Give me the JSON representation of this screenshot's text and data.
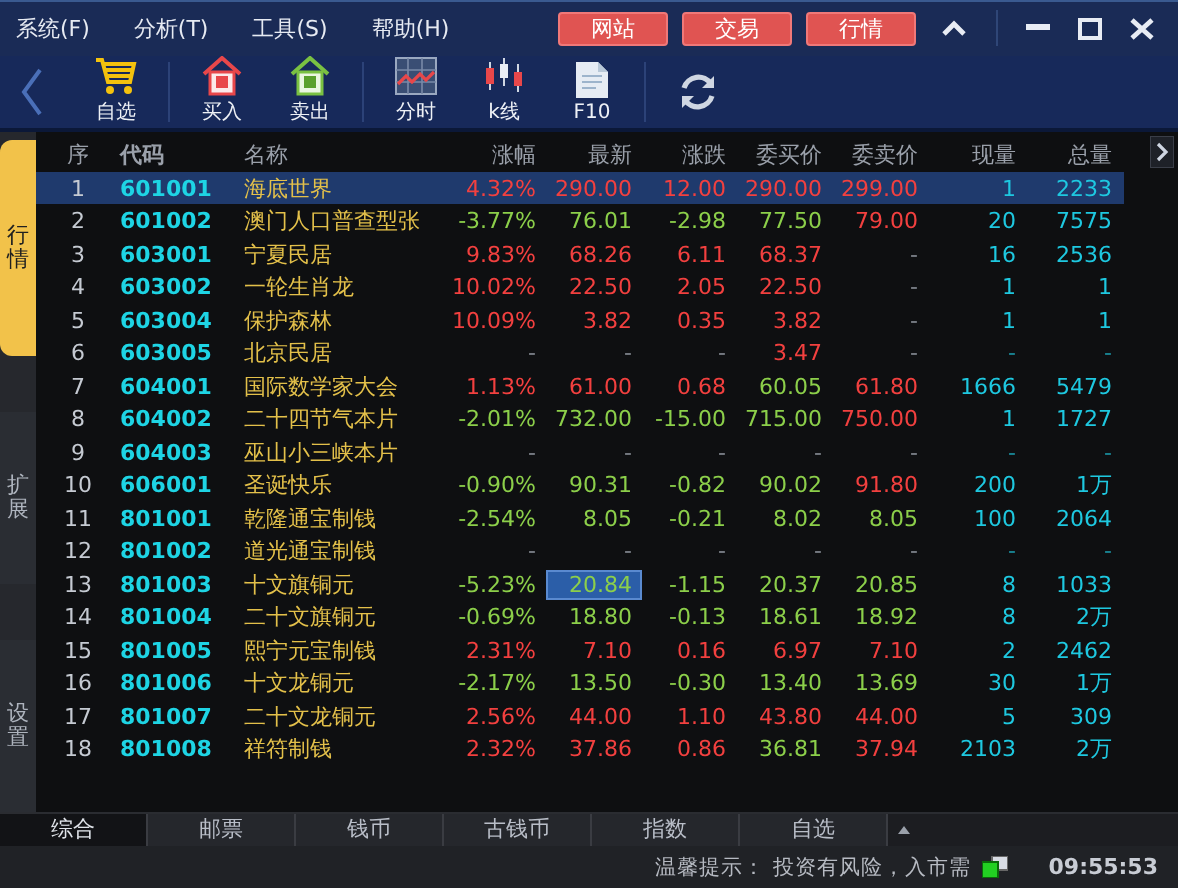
{
  "menu": [
    "系统(F)",
    "分析(T)",
    "工具(S)",
    "帮助(H)"
  ],
  "top_buttons": [
    "网站",
    "交易",
    "行情"
  ],
  "toolbar": [
    {
      "label": "自选",
      "kind": "cart"
    },
    {
      "label": "买入",
      "kind": "buy"
    },
    {
      "label": "卖出",
      "kind": "sell"
    },
    {
      "label": "分时",
      "kind": "intraday"
    },
    {
      "label": "k线",
      "kind": "kline"
    },
    {
      "label": "F10",
      "kind": "doc"
    },
    {
      "kind": "refresh"
    }
  ],
  "side_tabs": [
    {
      "label": "行情",
      "selected": true
    },
    {
      "label": "扩展",
      "selected": false
    },
    {
      "label": "设置",
      "selected": false
    }
  ],
  "table": {
    "columns": [
      "序",
      "代码",
      "名称",
      "涨幅",
      "最新",
      "涨跌",
      "委买价",
      "委卖价",
      "现量",
      "总量"
    ],
    "rows": [
      {
        "selected": true,
        "cells": [
          {
            "text": "1",
            "color": "#c5cad2",
            "selected": false
          },
          {
            "text": "601001",
            "color": "#1ed4e4",
            "selected": false
          },
          {
            "text": "海底世界",
            "color": "#e3c04a",
            "selected": false
          },
          {
            "text": "4.32%",
            "color": "#f2403f",
            "selected": false
          },
          {
            "text": "290.00",
            "color": "#f2403f",
            "selected": false
          },
          {
            "text": "12.00",
            "color": "#f2403f",
            "selected": false
          },
          {
            "text": "290.00",
            "color": "#f2403f",
            "selected": false
          },
          {
            "text": "299.00",
            "color": "#f2403f",
            "selected": false
          },
          {
            "text": "1",
            "color": "#1ec8e0",
            "selected": false
          },
          {
            "text": "2233",
            "color": "#1ec8e0",
            "selected": false
          }
        ]
      },
      {
        "selected": false,
        "cells": [
          {
            "text": "2",
            "color": "#c5cad2",
            "selected": false
          },
          {
            "text": "601002",
            "color": "#1ed4e4",
            "selected": false
          },
          {
            "text": "澳门人口普查型张",
            "color": "#e3c04a",
            "selected": false
          },
          {
            "text": "-3.77%",
            "color": "#8ccf4a",
            "selected": false
          },
          {
            "text": "76.01",
            "color": "#8ccf4a",
            "selected": false
          },
          {
            "text": "-2.98",
            "color": "#8ccf4a",
            "selected": false
          },
          {
            "text": "77.50",
            "color": "#8ccf4a",
            "selected": false
          },
          {
            "text": "79.00",
            "color": "#f2403f",
            "selected": false
          },
          {
            "text": "20",
            "color": "#1ec8e0",
            "selected": false
          },
          {
            "text": "7575",
            "color": "#1ec8e0",
            "selected": false
          }
        ]
      },
      {
        "selected": false,
        "cells": [
          {
            "text": "3",
            "color": "#c5cad2",
            "selected": false
          },
          {
            "text": "603001",
            "color": "#1ed4e4",
            "selected": false
          },
          {
            "text": "宁夏民居",
            "color": "#e3c04a",
            "selected": false
          },
          {
            "text": "9.83%",
            "color": "#f2403f",
            "selected": false
          },
          {
            "text": "68.26",
            "color": "#f2403f",
            "selected": false
          },
          {
            "text": "6.11",
            "color": "#f2403f",
            "selected": false
          },
          {
            "text": "68.37",
            "color": "#f2403f",
            "selected": false
          },
          {
            "text": "-",
            "color": "#7d828a",
            "selected": false
          },
          {
            "text": "16",
            "color": "#1ec8e0",
            "selected": false
          },
          {
            "text": "2536",
            "color": "#1ec8e0",
            "selected": false
          }
        ]
      },
      {
        "selected": false,
        "cells": [
          {
            "text": "4",
            "color": "#c5cad2",
            "selected": false
          },
          {
            "text": "603002",
            "color": "#1ed4e4",
            "selected": false
          },
          {
            "text": "一轮生肖龙",
            "color": "#e3c04a",
            "selected": false
          },
          {
            "text": "10.02%",
            "color": "#f2403f",
            "selected": false
          },
          {
            "text": "22.50",
            "color": "#f2403f",
            "selected": false
          },
          {
            "text": "2.05",
            "color": "#f2403f",
            "selected": false
          },
          {
            "text": "22.50",
            "color": "#f2403f",
            "selected": false
          },
          {
            "text": "-",
            "color": "#7d828a",
            "selected": false
          },
          {
            "text": "1",
            "color": "#1ec8e0",
            "selected": false
          },
          {
            "text": "1",
            "color": "#1ec8e0",
            "selected": false
          }
        ]
      },
      {
        "selected": false,
        "cells": [
          {
            "text": "5",
            "color": "#c5cad2",
            "selected": false
          },
          {
            "text": "603004",
            "color": "#1ed4e4",
            "selected": false
          },
          {
            "text": "保护森林",
            "color": "#e3c04a",
            "selected": false
          },
          {
            "text": "10.09%",
            "color": "#f2403f",
            "selected": false
          },
          {
            "text": "3.82",
            "color": "#f2403f",
            "selected": false
          },
          {
            "text": "0.35",
            "color": "#f2403f",
            "selected": false
          },
          {
            "text": "3.82",
            "color": "#f2403f",
            "selected": false
          },
          {
            "text": "-",
            "color": "#7d828a",
            "selected": false
          },
          {
            "text": "1",
            "color": "#1ec8e0",
            "selected": false
          },
          {
            "text": "1",
            "color": "#1ec8e0",
            "selected": false
          }
        ]
      },
      {
        "selected": false,
        "cells": [
          {
            "text": "6",
            "color": "#c5cad2",
            "selected": false
          },
          {
            "text": "603005",
            "color": "#1ed4e4",
            "selected": false
          },
          {
            "text": "北京民居",
            "color": "#e3c04a",
            "selected": false
          },
          {
            "text": "-",
            "color": "#7d828a",
            "selected": false
          },
          {
            "text": "-",
            "color": "#7d828a",
            "selected": false
          },
          {
            "text": "-",
            "color": "#7d828a",
            "selected": false
          },
          {
            "text": "3.47",
            "color": "#f2403f",
            "selected": false
          },
          {
            "text": "-",
            "color": "#7d828a",
            "selected": false
          },
          {
            "text": "-",
            "color": "#1a8a9a",
            "selected": false
          },
          {
            "text": "-",
            "color": "#1a8a9a",
            "selected": false
          }
        ]
      },
      {
        "selected": false,
        "cells": [
          {
            "text": "7",
            "color": "#c5cad2",
            "selected": false
          },
          {
            "text": "604001",
            "color": "#1ed4e4",
            "selected": false
          },
          {
            "text": "国际数学家大会",
            "color": "#e3c04a",
            "selected": false
          },
          {
            "text": "1.13%",
            "color": "#f2403f",
            "selected": false
          },
          {
            "text": "61.00",
            "color": "#f2403f",
            "selected": false
          },
          {
            "text": "0.68",
            "color": "#f2403f",
            "selected": false
          },
          {
            "text": "60.05",
            "color": "#8ccf4a",
            "selected": false
          },
          {
            "text": "61.80",
            "color": "#f2403f",
            "selected": false
          },
          {
            "text": "1666",
            "color": "#1ec8e0",
            "selected": false
          },
          {
            "text": "5479",
            "color": "#1ec8e0",
            "selected": false
          }
        ]
      },
      {
        "selected": false,
        "cells": [
          {
            "text": "8",
            "color": "#c5cad2",
            "selected": false
          },
          {
            "text": "604002",
            "color": "#1ed4e4",
            "selected": false
          },
          {
            "text": "二十四节气本片",
            "color": "#e3c04a",
            "selected": false
          },
          {
            "text": "-2.01%",
            "color": "#8ccf4a",
            "selected": false
          },
          {
            "text": "732.00",
            "color": "#8ccf4a",
            "selected": false
          },
          {
            "text": "-15.00",
            "color": "#8ccf4a",
            "selected": false
          },
          {
            "text": "715.00",
            "color": "#8ccf4a",
            "selected": false
          },
          {
            "text": "750.00",
            "color": "#f2403f",
            "selected": false
          },
          {
            "text": "1",
            "color": "#1ec8e0",
            "selected": false
          },
          {
            "text": "1727",
            "color": "#1ec8e0",
            "selected": false
          }
        ]
      },
      {
        "selected": false,
        "cells": [
          {
            "text": "9",
            "color": "#c5cad2",
            "selected": false
          },
          {
            "text": "604003",
            "color": "#1ed4e4",
            "selected": false
          },
          {
            "text": "巫山小三峡本片",
            "color": "#e3c04a",
            "selected": false
          },
          {
            "text": "-",
            "color": "#7d828a",
            "selected": false
          },
          {
            "text": "-",
            "color": "#7d828a",
            "selected": false
          },
          {
            "text": "-",
            "color": "#7d828a",
            "selected": false
          },
          {
            "text": "-",
            "color": "#7d828a",
            "selected": false
          },
          {
            "text": "-",
            "color": "#7d828a",
            "selected": false
          },
          {
            "text": "-",
            "color": "#1a8a9a",
            "selected": false
          },
          {
            "text": "-",
            "color": "#1a8a9a",
            "selected": false
          }
        ]
      },
      {
        "selected": false,
        "cells": [
          {
            "text": "10",
            "color": "#c5cad2",
            "selected": false
          },
          {
            "text": "606001",
            "color": "#1ed4e4",
            "selected": false
          },
          {
            "text": "圣诞快乐",
            "color": "#e3c04a",
            "selected": false
          },
          {
            "text": "-0.90%",
            "color": "#8ccf4a",
            "selected": false
          },
          {
            "text": "90.31",
            "color": "#8ccf4a",
            "selected": false
          },
          {
            "text": "-0.82",
            "color": "#8ccf4a",
            "selected": false
          },
          {
            "text": "90.02",
            "color": "#8ccf4a",
            "selected": false
          },
          {
            "text": "91.80",
            "color": "#f2403f",
            "selected": false
          },
          {
            "text": "200",
            "color": "#1ec8e0",
            "selected": false
          },
          {
            "text": "1万",
            "color": "#1ec8e0",
            "selected": false
          }
        ]
      },
      {
        "selected": false,
        "cells": [
          {
            "text": "11",
            "color": "#c5cad2",
            "selected": false
          },
          {
            "text": "801001",
            "color": "#1ed4e4",
            "selected": false
          },
          {
            "text": "乾隆通宝制钱",
            "color": "#e3c04a",
            "selected": false
          },
          {
            "text": "-2.54%",
            "color": "#8ccf4a",
            "selected": false
          },
          {
            "text": "8.05",
            "color": "#8ccf4a",
            "selected": false
          },
          {
            "text": "-0.21",
            "color": "#8ccf4a",
            "selected": false
          },
          {
            "text": "8.02",
            "color": "#8ccf4a",
            "selected": false
          },
          {
            "text": "8.05",
            "color": "#8ccf4a",
            "selected": false
          },
          {
            "text": "100",
            "color": "#1ec8e0",
            "selected": false
          },
          {
            "text": "2064",
            "color": "#1ec8e0",
            "selected": false
          }
        ]
      },
      {
        "selected": false,
        "cells": [
          {
            "text": "12",
            "color": "#c5cad2",
            "selected": false
          },
          {
            "text": "801002",
            "color": "#1ed4e4",
            "selected": false
          },
          {
            "text": "道光通宝制钱",
            "color": "#e3c04a",
            "selected": false
          },
          {
            "text": "-",
            "color": "#7d828a",
            "selected": false
          },
          {
            "text": "-",
            "color": "#7d828a",
            "selected": false
          },
          {
            "text": "-",
            "color": "#7d828a",
            "selected": false
          },
          {
            "text": "-",
            "color": "#7d828a",
            "selected": false
          },
          {
            "text": "-",
            "color": "#7d828a",
            "selected": false
          },
          {
            "text": "-",
            "color": "#1a8a9a",
            "selected": false
          },
          {
            "text": "-",
            "color": "#1a8a9a",
            "selected": false
          }
        ]
      },
      {
        "selected": false,
        "cells": [
          {
            "text": "13",
            "color": "#c5cad2",
            "selected": false
          },
          {
            "text": "801003",
            "color": "#1ed4e4",
            "selected": false
          },
          {
            "text": "十文旗铜元",
            "color": "#e3c04a",
            "selected": false
          },
          {
            "text": "-5.23%",
            "color": "#8ccf4a",
            "selected": false
          },
          {
            "text": "20.84",
            "color": "#8ccf4a",
            "selected": true
          },
          {
            "text": "-1.15",
            "color": "#8ccf4a",
            "selected": false
          },
          {
            "text": "20.37",
            "color": "#8ccf4a",
            "selected": false
          },
          {
            "text": "20.85",
            "color": "#8ccf4a",
            "selected": false
          },
          {
            "text": "8",
            "color": "#1ec8e0",
            "selected": false
          },
          {
            "text": "1033",
            "color": "#1ec8e0",
            "selected": false
          }
        ]
      },
      {
        "selected": false,
        "cells": [
          {
            "text": "14",
            "color": "#c5cad2",
            "selected": false
          },
          {
            "text": "801004",
            "color": "#1ed4e4",
            "selected": false
          },
          {
            "text": "二十文旗铜元",
            "color": "#e3c04a",
            "selected": false
          },
          {
            "text": "-0.69%",
            "color": "#8ccf4a",
            "selected": false
          },
          {
            "text": "18.80",
            "color": "#8ccf4a",
            "selected": false
          },
          {
            "text": "-0.13",
            "color": "#8ccf4a",
            "selected": false
          },
          {
            "text": "18.61",
            "color": "#8ccf4a",
            "selected": false
          },
          {
            "text": "18.92",
            "color": "#8ccf4a",
            "selected": false
          },
          {
            "text": "8",
            "color": "#1ec8e0",
            "selected": false
          },
          {
            "text": "2万",
            "color": "#1ec8e0",
            "selected": false
          }
        ]
      },
      {
        "selected": false,
        "cells": [
          {
            "text": "15",
            "color": "#c5cad2",
            "selected": false
          },
          {
            "text": "801005",
            "color": "#1ed4e4",
            "selected": false
          },
          {
            "text": "熙宁元宝制钱",
            "color": "#e3c04a",
            "selected": false
          },
          {
            "text": "2.31%",
            "color": "#f2403f",
            "selected": false
          },
          {
            "text": "7.10",
            "color": "#f2403f",
            "selected": false
          },
          {
            "text": "0.16",
            "color": "#f2403f",
            "selected": false
          },
          {
            "text": "6.97",
            "color": "#f2403f",
            "selected": false
          },
          {
            "text": "7.10",
            "color": "#f2403f",
            "selected": false
          },
          {
            "text": "2",
            "color": "#1ec8e0",
            "selected": false
          },
          {
            "text": "2462",
            "color": "#1ec8e0",
            "selected": false
          }
        ]
      },
      {
        "selected": false,
        "cells": [
          {
            "text": "16",
            "color": "#c5cad2",
            "selected": false
          },
          {
            "text": "801006",
            "color": "#1ed4e4",
            "selected": false
          },
          {
            "text": "十文龙铜元",
            "color": "#e3c04a",
            "selected": false
          },
          {
            "text": "-2.17%",
            "color": "#8ccf4a",
            "selected": false
          },
          {
            "text": "13.50",
            "color": "#8ccf4a",
            "selected": false
          },
          {
            "text": "-0.30",
            "color": "#8ccf4a",
            "selected": false
          },
          {
            "text": "13.40",
            "color": "#8ccf4a",
            "selected": false
          },
          {
            "text": "13.69",
            "color": "#8ccf4a",
            "selected": false
          },
          {
            "text": "30",
            "color": "#1ec8e0",
            "selected": false
          },
          {
            "text": "1万",
            "color": "#1ec8e0",
            "selected": false
          }
        ]
      },
      {
        "selected": false,
        "cells": [
          {
            "text": "17",
            "color": "#c5cad2",
            "selected": false
          },
          {
            "text": "801007",
            "color": "#1ed4e4",
            "selected": false
          },
          {
            "text": "二十文龙铜元",
            "color": "#e3c04a",
            "selected": false
          },
          {
            "text": "2.56%",
            "color": "#f2403f",
            "selected": false
          },
          {
            "text": "44.00",
            "color": "#f2403f",
            "selected": false
          },
          {
            "text": "1.10",
            "color": "#f2403f",
            "selected": false
          },
          {
            "text": "43.80",
            "color": "#f2403f",
            "selected": false
          },
          {
            "text": "44.00",
            "color": "#f2403f",
            "selected": false
          },
          {
            "text": "5",
            "color": "#1ec8e0",
            "selected": false
          },
          {
            "text": "309",
            "color": "#1ec8e0",
            "selected": false
          }
        ]
      },
      {
        "selected": false,
        "cells": [
          {
            "text": "18",
            "color": "#c5cad2",
            "selected": false
          },
          {
            "text": "801008",
            "color": "#1ed4e4",
            "selected": false
          },
          {
            "text": "祥符制钱",
            "color": "#e3c04a",
            "selected": false
          },
          {
            "text": "2.32%",
            "color": "#f2403f",
            "selected": false
          },
          {
            "text": "37.86",
            "color": "#f2403f",
            "selected": false
          },
          {
            "text": "0.86",
            "color": "#f2403f",
            "selected": false
          },
          {
            "text": "36.81",
            "color": "#8ccf4a",
            "selected": false
          },
          {
            "text": "37.94",
            "color": "#f2403f",
            "selected": false
          },
          {
            "text": "2103",
            "color": "#1ec8e0",
            "selected": false
          },
          {
            "text": "2万",
            "color": "#1ec8e0",
            "selected": false
          }
        ]
      }
    ]
  },
  "bottom_tabs": [
    {
      "label": "综合",
      "selected": true
    },
    {
      "label": "邮票",
      "selected": false
    },
    {
      "label": "钱币",
      "selected": false
    },
    {
      "label": "古钱币",
      "selected": false
    },
    {
      "label": "指数",
      "selected": false
    },
    {
      "label": "自选",
      "selected": false
    }
  ],
  "status_bar": {
    "hint_label": "温馨提示：",
    "hint": "投资有风险，入市需",
    "time": "09:55:53"
  }
}
